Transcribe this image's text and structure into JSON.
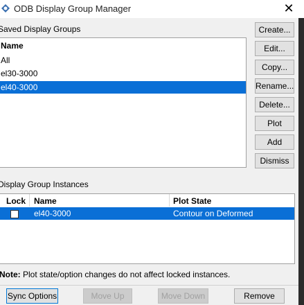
{
  "window": {
    "title": "ODB Display Group Manager",
    "close_glyph": "✕"
  },
  "saved_groups": {
    "label": "Saved Display Groups",
    "header": "Name",
    "items": [
      "All",
      "el30-3000",
      "el40-3000"
    ],
    "selected_index": 2
  },
  "side_buttons": {
    "create": "Create...",
    "edit": "Edit...",
    "copy": "Copy...",
    "rename": "Rename...",
    "delete": "Delete...",
    "plot": "Plot",
    "add": "Add",
    "dismiss": "Dismiss"
  },
  "instances": {
    "label": "Display Group Instances",
    "columns": [
      "Lock",
      "Name",
      "Plot State"
    ],
    "rows": [
      {
        "lock": false,
        "name": "el40-3000",
        "plot_state": "Contour on Deformed"
      }
    ]
  },
  "note": {
    "prefix": "Note:",
    "text": "Plot state/option changes do not affect locked instances."
  },
  "bottom_buttons": {
    "sync": "Sync Options",
    "move_up": "Move Up",
    "move_down": "Move Down",
    "remove": "Remove"
  },
  "colors": {
    "selection": "#0a6fd6",
    "window_bg": "#f0f0f0"
  }
}
